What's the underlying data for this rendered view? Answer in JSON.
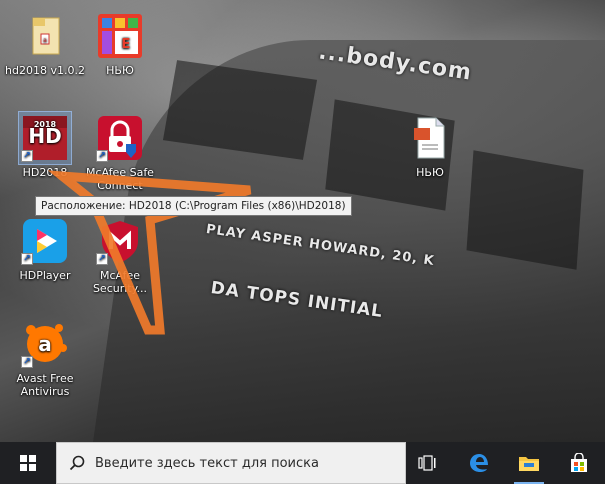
{
  "desktop": {
    "wallpaper_text": {
      "url": "...body.com",
      "sign1": "PLAY ASPER HOWARD, 20, K",
      "sign2": "DA TOPS INITIAL"
    },
    "icons": [
      {
        "id": "hd2018-folder",
        "label": "hd2018 v1.0.2"
      },
      {
        "id": "nyu-app",
        "label": "НЬЮ"
      },
      {
        "id": "hd2018-app",
        "label": "HD2018",
        "tile_top": "2018",
        "tile_main": "HD"
      },
      {
        "id": "mcafee-safe",
        "label": "McAfee Safe Connect"
      },
      {
        "id": "nyu-file",
        "label": "НЬЮ"
      },
      {
        "id": "hdplayer",
        "label": "HDPlayer"
      },
      {
        "id": "mcafee-security",
        "label": "McAfee Security..."
      },
      {
        "id": "avast",
        "label": "Avast Free Antivirus"
      }
    ],
    "tooltip": "Расположение: HD2018 (C:\\Program Files (x86)\\HD2018)",
    "annotation_color": "#f07a2a"
  },
  "taskbar": {
    "search_placeholder": "Введите здесь текст для поиска",
    "apps": [
      "task-view",
      "edge",
      "file-explorer",
      "store"
    ]
  }
}
